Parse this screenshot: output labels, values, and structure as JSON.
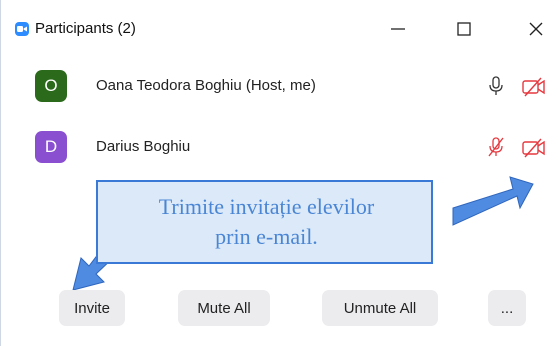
{
  "window": {
    "title": "Participants (2)",
    "controls": {
      "minimize": "minimize-icon",
      "maximize": "maximize-icon",
      "close": "close-icon"
    }
  },
  "participants": [
    {
      "initial": "O",
      "name": "Oana Teodora Boghiu (Host, me)",
      "color": "#2b6a1b",
      "mic": "on",
      "video": "off"
    },
    {
      "initial": "D",
      "name": "Darius Boghiu",
      "color": "#8a4fd0",
      "mic": "muted",
      "video": "off"
    }
  ],
  "callout": {
    "line1": "Trimite invitație elevilor",
    "line2": "prin e-mail."
  },
  "footer": {
    "invite": "Invite",
    "mute_all": "Mute All",
    "unmute_all": "Unmute All",
    "more": "..."
  },
  "colors": {
    "accent_blue": "#3a7ad6",
    "muted_red": "#e5393f",
    "zoom_blue": "#2d8cff"
  }
}
